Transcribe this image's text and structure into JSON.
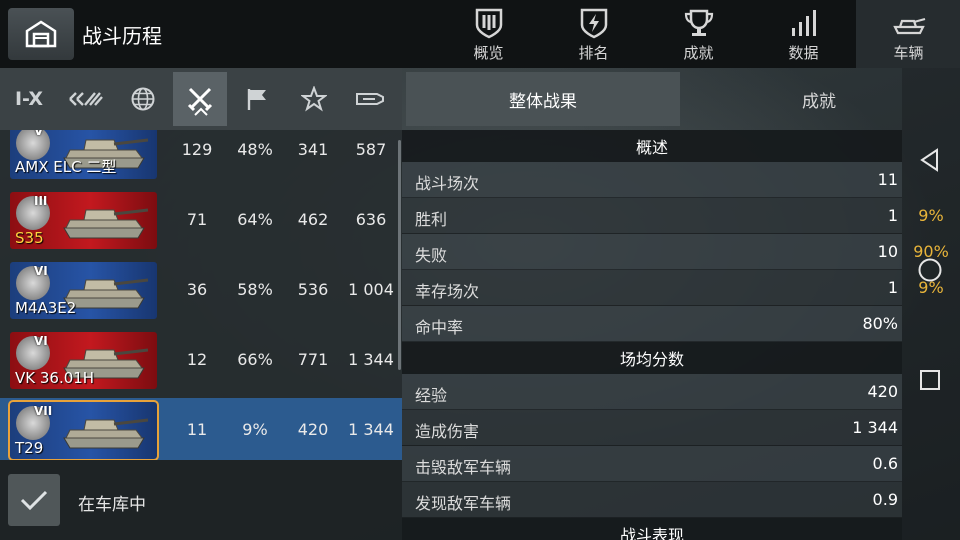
{
  "header": {
    "title": "战斗历程",
    "tabs": [
      {
        "label": "概览",
        "icon": "shield-icon"
      },
      {
        "label": "排名",
        "icon": "ranking-shield-icon"
      },
      {
        "label": "成就",
        "icon": "trophy-icon"
      },
      {
        "label": "数据",
        "icon": "bar-chart-icon"
      },
      {
        "label": "车辆",
        "icon": "tank-icon"
      }
    ],
    "active_tab": "车辆"
  },
  "filters": {
    "tier_label": "I-X",
    "items": [
      "tier-filter",
      "nation-filter",
      "globe-filter",
      "battles-filter",
      "flag-filter",
      "star-filter",
      "gun-filter"
    ],
    "active": "battles-filter"
  },
  "vehicles": [
    {
      "tier": "V",
      "name": "AMX ELC 二型",
      "battles": "129",
      "winrate": "48%",
      "avg_xp": "341",
      "avg_damage": "587",
      "flag": "blue"
    },
    {
      "tier": "III",
      "name": "S35",
      "battles": "71",
      "winrate": "64%",
      "avg_xp": "462",
      "avg_damage": "636",
      "flag": "red",
      "gold": true
    },
    {
      "tier": "VI",
      "name": "M4A3E2",
      "battles": "36",
      "winrate": "58%",
      "avg_xp": "536",
      "avg_damage": "1 004",
      "flag": "blue"
    },
    {
      "tier": "VI",
      "name": "VK 36.01H",
      "battles": "12",
      "winrate": "66%",
      "avg_xp": "771",
      "avg_damage": "1 344",
      "flag": "red"
    },
    {
      "tier": "VII",
      "name": "T29",
      "battles": "11",
      "winrate": "9%",
      "avg_xp": "420",
      "avg_damage": "1 344",
      "flag": "blue",
      "selected": true
    }
  ],
  "garage_filter": {
    "label": "在车库中",
    "checked": true
  },
  "right_tabs": {
    "overall": "整体战果",
    "achievements": "成就"
  },
  "overview": {
    "title": "概述",
    "rows": [
      {
        "label": "战斗场次",
        "value": "11",
        "pct": ""
      },
      {
        "label": "胜利",
        "value": "1",
        "pct": "9%"
      },
      {
        "label": "失败",
        "value": "10",
        "pct": "90%"
      },
      {
        "label": "幸存场次",
        "value": "1",
        "pct": "9%"
      },
      {
        "label": "命中率",
        "value": "80%",
        "pct": ""
      }
    ]
  },
  "per_battle": {
    "title": "场均分数",
    "rows": [
      {
        "label": "经验",
        "value": "420"
      },
      {
        "label": "造成伤害",
        "value": "1 344"
      },
      {
        "label": "击毁敌军车辆",
        "value": "0.6"
      },
      {
        "label": "发现敌军车辆",
        "value": "0.9"
      }
    ]
  },
  "performance": {
    "title": "战斗表现"
  },
  "colors": {
    "accent_gold": "#e8b43a",
    "selected_row": "#2c5b8f",
    "selected_outline": "#e8a23a"
  }
}
